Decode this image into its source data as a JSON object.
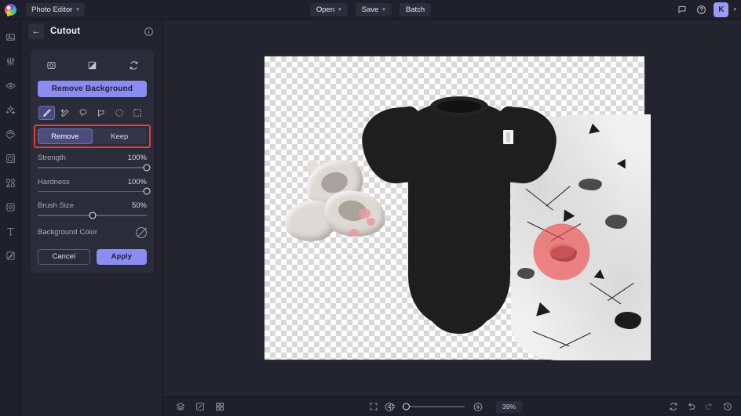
{
  "topbar": {
    "logo_icon": "colorwheel-logo-icon",
    "app_menu_label": "Photo Editor",
    "open_label": "Open",
    "save_label": "Save",
    "batch_label": "Batch",
    "feedback_icon": "comment-icon",
    "help_icon": "help-circle-icon",
    "avatar_initial": "K",
    "accent_color": "#8b8cf0"
  },
  "rail": {
    "items": [
      {
        "icon": "image-crop-icon",
        "name": "sidebar-item-crop"
      },
      {
        "icon": "sliders-adjust-icon",
        "name": "sidebar-item-adjust"
      },
      {
        "icon": "eye-retouch-icon",
        "name": "sidebar-item-retouch"
      },
      {
        "icon": "sparkles-ai-icon",
        "name": "sidebar-item-ai"
      },
      {
        "icon": "palette-effects-icon",
        "name": "sidebar-item-effects"
      },
      {
        "icon": "frame-border-icon",
        "name": "sidebar-item-frame"
      },
      {
        "icon": "shapes-elements-icon",
        "name": "sidebar-item-elements"
      },
      {
        "icon": "cutout-icon",
        "name": "sidebar-item-cutout"
      },
      {
        "icon": "text-tool-icon",
        "name": "sidebar-item-text"
      },
      {
        "icon": "mask-layer-icon",
        "name": "sidebar-item-mask"
      }
    ]
  },
  "panel": {
    "back_icon": "arrow-left-icon",
    "title": "Cutout",
    "info_icon": "info-circle-icon",
    "modes": [
      {
        "icon": "object-select-icon",
        "name": "mode-object-select"
      },
      {
        "icon": "mask-preview-icon",
        "name": "mode-mask-preview"
      },
      {
        "icon": "refresh-reset-icon",
        "name": "mode-reset"
      }
    ],
    "remove_background_label": "Remove Background",
    "tools": [
      {
        "icon": "brush-icon",
        "name": "tool-brush",
        "active": true
      },
      {
        "icon": "magic-wand-icon",
        "name": "tool-magic-wand",
        "active": false
      },
      {
        "icon": "lasso-icon",
        "name": "tool-lasso",
        "active": false
      },
      {
        "icon": "polygon-lasso-icon",
        "name": "tool-polygon-lasso",
        "active": false
      },
      {
        "icon": "ellipse-select-icon",
        "name": "tool-ellipse-select",
        "active": false
      },
      {
        "icon": "rect-select-icon",
        "name": "tool-rect-select",
        "active": false
      }
    ],
    "segmented": {
      "remove_label": "Remove",
      "keep_label": "Keep",
      "selected": "Remove",
      "highlight_color": "#ef3b30"
    },
    "sliders": [
      {
        "label": "Strength",
        "value": "100%",
        "percent": 100
      },
      {
        "label": "Hardness",
        "value": "100%",
        "percent": 100
      },
      {
        "label": "Brush Size",
        "value": "50%",
        "percent": 50
      }
    ],
    "background_color": {
      "label": "Background Color",
      "swatch_icon": "no-color-icon"
    },
    "cancel_label": "Cancel",
    "apply_label": "Apply"
  },
  "bottombar": {
    "layers_icon": "layers-icon",
    "compare_icon": "compare-link-icon",
    "grid_icon": "grid-view-icon",
    "fit_screen_icon": "fit-screen-icon",
    "shrink_icon": "shrink-icon",
    "zoom_out_icon": "zoom-out-icon",
    "zoom_in_icon": "zoom-in-icon",
    "zoom_value": "39%",
    "zoom_percent": 39,
    "reset_icon": "reset-rotate-icon",
    "undo_icon": "undo-icon",
    "redo_icon": "redo-icon",
    "history_icon": "history-clock-icon"
  },
  "canvas": {
    "name": "image-canvas",
    "transparency": "checkerboard",
    "brush_mark": "red-brush-stroke"
  }
}
